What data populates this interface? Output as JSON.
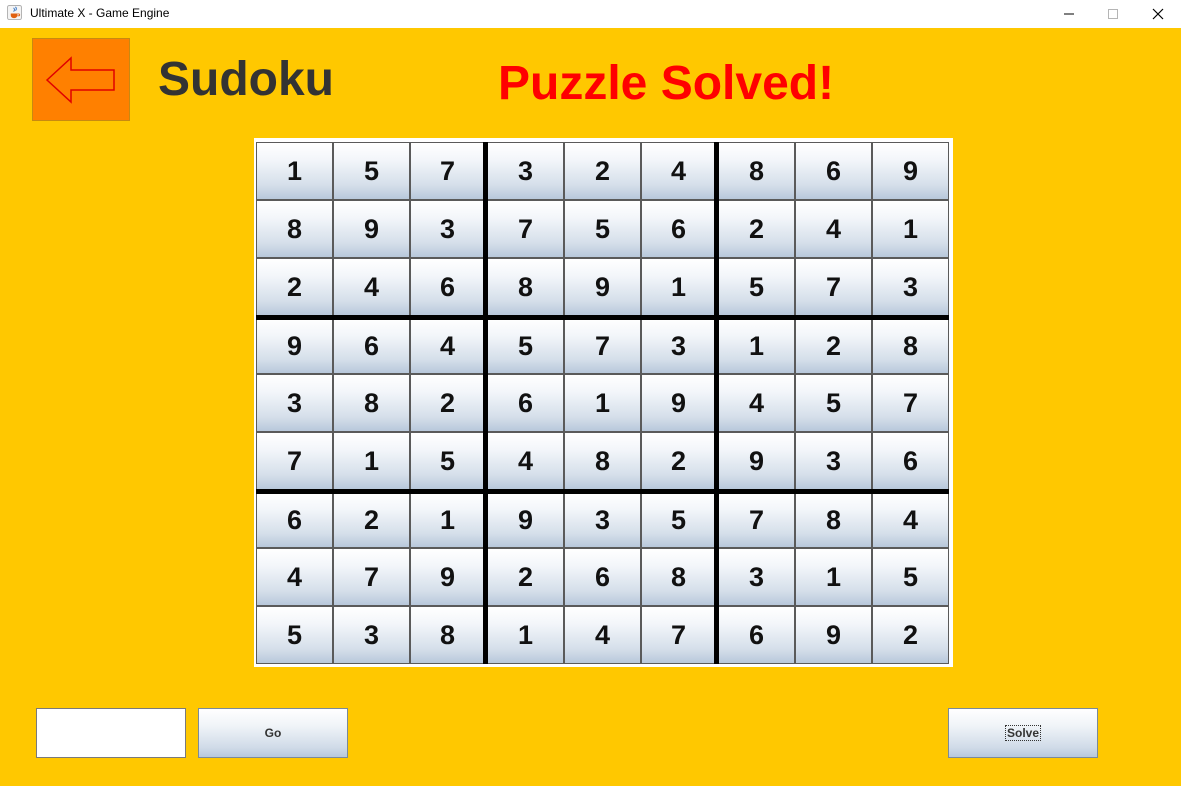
{
  "window": {
    "title": "Ultimate X - Game Engine",
    "icons": [
      "java-cup-icon",
      "minimize-icon",
      "maximize-icon",
      "close-icon"
    ]
  },
  "header": {
    "title": "Sudoku",
    "status": "Puzzle Solved!",
    "back_icon": "left-arrow-icon"
  },
  "board": [
    [
      "1",
      "5",
      "7",
      "3",
      "2",
      "4",
      "8",
      "6",
      "9"
    ],
    [
      "8",
      "9",
      "3",
      "7",
      "5",
      "6",
      "2",
      "4",
      "1"
    ],
    [
      "2",
      "4",
      "6",
      "8",
      "9",
      "1",
      "5",
      "7",
      "3"
    ],
    [
      "9",
      "6",
      "4",
      "5",
      "7",
      "3",
      "1",
      "2",
      "8"
    ],
    [
      "3",
      "8",
      "2",
      "6",
      "1",
      "9",
      "4",
      "5",
      "7"
    ],
    [
      "7",
      "1",
      "5",
      "4",
      "8",
      "2",
      "9",
      "3",
      "6"
    ],
    [
      "6",
      "2",
      "1",
      "9",
      "3",
      "5",
      "7",
      "8",
      "4"
    ],
    [
      "4",
      "7",
      "9",
      "2",
      "6",
      "8",
      "3",
      "1",
      "5"
    ],
    [
      "5",
      "3",
      "8",
      "1",
      "4",
      "7",
      "6",
      "9",
      "2"
    ]
  ],
  "controls": {
    "input_value": "",
    "go_label": "Go",
    "solve_label": "Solve"
  },
  "colors": {
    "background": "#ffc800",
    "back_button": "#ff8000",
    "status_text": "#ff0000",
    "title_text": "#333333"
  }
}
